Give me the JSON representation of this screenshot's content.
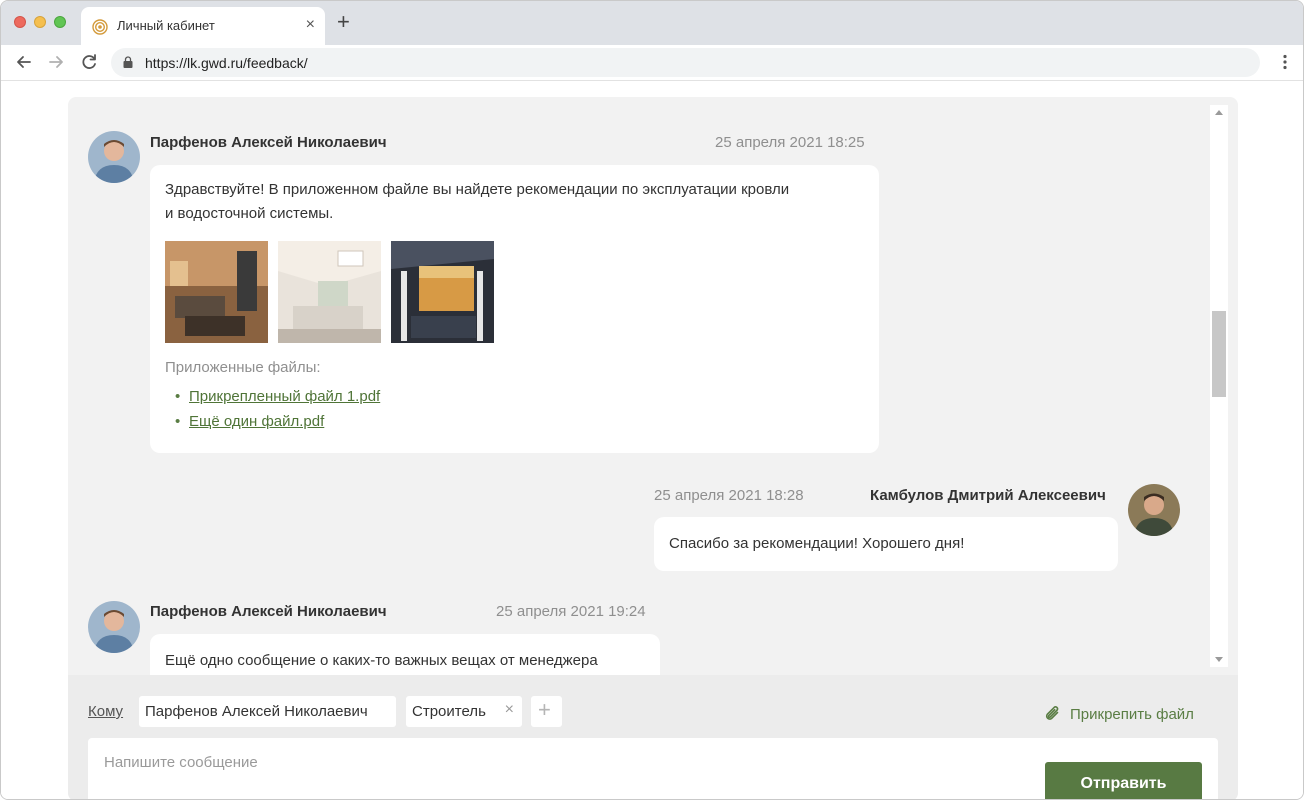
{
  "browser": {
    "tab_title": "Личный кабинет",
    "tab_close": "×",
    "new_tab": "+",
    "url": "https://lk.gwd.ru/feedback/"
  },
  "messages": [
    {
      "author": "Парфенов Алексей Николаевич",
      "time": "25 апреля 2021 18:25",
      "text_line1": "Здравствуйте! В приложенном файле вы найдете рекомендации по эксплуатации кровли",
      "text_line2": "и водосточной системы.",
      "images": [
        "interior-living-room",
        "interior-bright-room",
        "terrace-autumn"
      ],
      "files_label": "Приложенные файлы:",
      "files": [
        "Прикрепленный файл 1.pdf",
        "Ещё один файл.pdf"
      ]
    },
    {
      "author": "Камбулов Дмитрий Алексеевич",
      "time": "25 апреля 2021 18:28",
      "text": "Спасибо за рекомендации! Хорошего дня!"
    },
    {
      "author": "Парфенов Алексей Николаевич",
      "time": "25 апреля 2021 19:24",
      "text": "Ещё одно сообщение о каких-то важных вещах от менеджера"
    }
  ],
  "composer": {
    "to_label": "Кому",
    "recipients": [
      "Парфенов Алексей Николаевич",
      "Строитель"
    ],
    "remove_symbol": "×",
    "add_symbol": "+",
    "attach_label": "Прикрепить файл",
    "placeholder": "Напишите сообщение",
    "send_label": "Отправить"
  },
  "colors": {
    "accent": "#587a43",
    "link": "#4f7437",
    "panel_bg": "#f2f2f2"
  }
}
